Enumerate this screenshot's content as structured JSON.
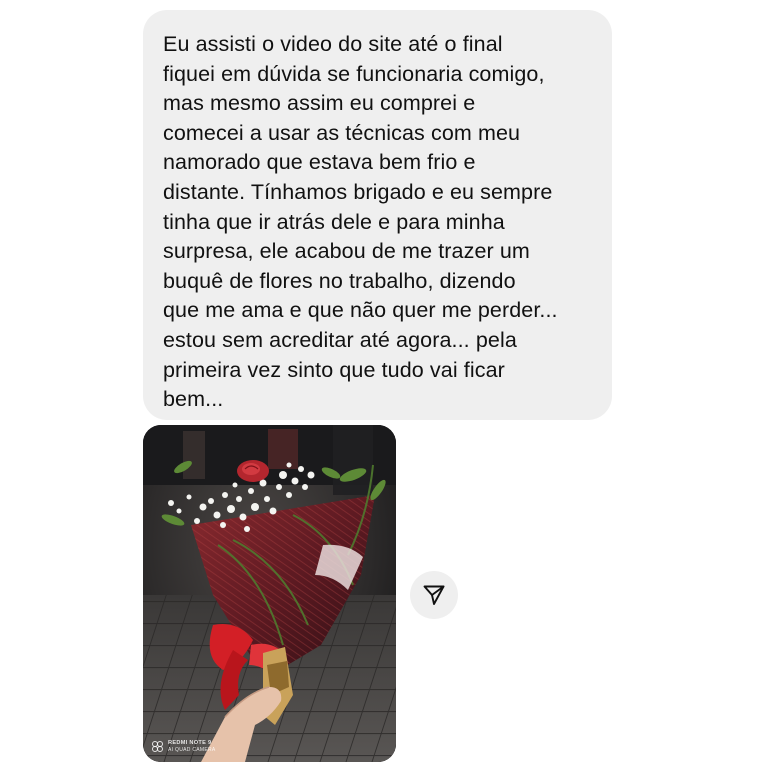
{
  "message": {
    "text": "Eu assisti o video do site até o final\nfiquei em dúvida se funcionaria comigo,\nmas mesmo assim eu comprei e\ncomecei a usar as técnicas com meu\nnamorado que estava bem frio e\ndistante. Tínhamos brigado e eu sempre\ntinha que ir atrás dele e para minha\nsurpresa, ele acabou de me trazer um\nbuquê de flores no trabalho, dizendo\nque me ama e que não quer me perder...\nestou sem acreditar até agora... pela\nprimeira vez sinto que tudo vai ficar\nbem..."
  },
  "photo": {
    "watermark_brand": "REDMI NOTE 9",
    "watermark_sub": "AI QUAD CAMERA"
  },
  "icons": {
    "share": "paper-plane-icon",
    "watermark_logo": "camera-rings-icon"
  },
  "colors": {
    "bubble_bg": "#efefef",
    "text": "#111111",
    "share_bg": "#efefef"
  }
}
